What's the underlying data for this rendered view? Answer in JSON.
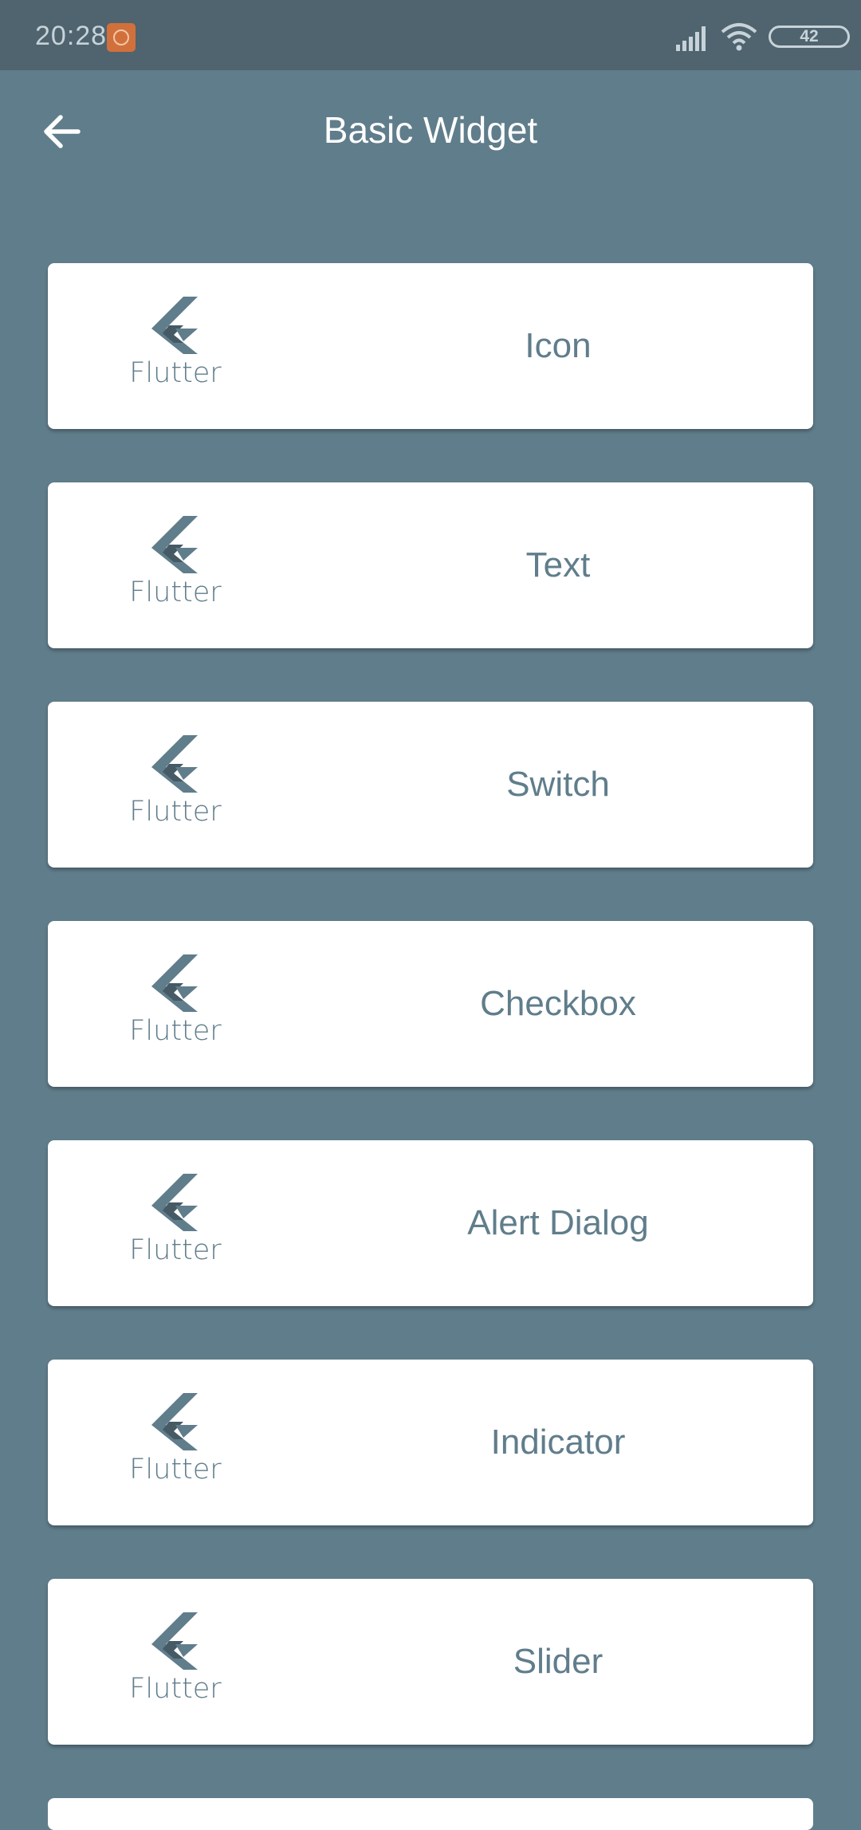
{
  "status_bar": {
    "time": "20:28",
    "battery": "42",
    "icons": [
      "mi-notification-icon",
      "signal-icon",
      "wifi-icon",
      "battery-icon"
    ]
  },
  "app_bar": {
    "title": "Basic Widget",
    "back_icon": "arrow-left-icon",
    "background": "#607d8b"
  },
  "colors": {
    "primary": "#607d8b",
    "status_bar": "#4f646f",
    "card": "#ffffff"
  },
  "items": [
    {
      "logo_caption": "Flutter",
      "label": "Icon"
    },
    {
      "logo_caption": "Flutter",
      "label": "Text"
    },
    {
      "logo_caption": "Flutter",
      "label": "Switch"
    },
    {
      "logo_caption": "Flutter",
      "label": "Checkbox"
    },
    {
      "logo_caption": "Flutter",
      "label": "Alert Dialog"
    },
    {
      "logo_caption": "Flutter",
      "label": "Indicator"
    },
    {
      "logo_caption": "Flutter",
      "label": "Slider"
    }
  ]
}
